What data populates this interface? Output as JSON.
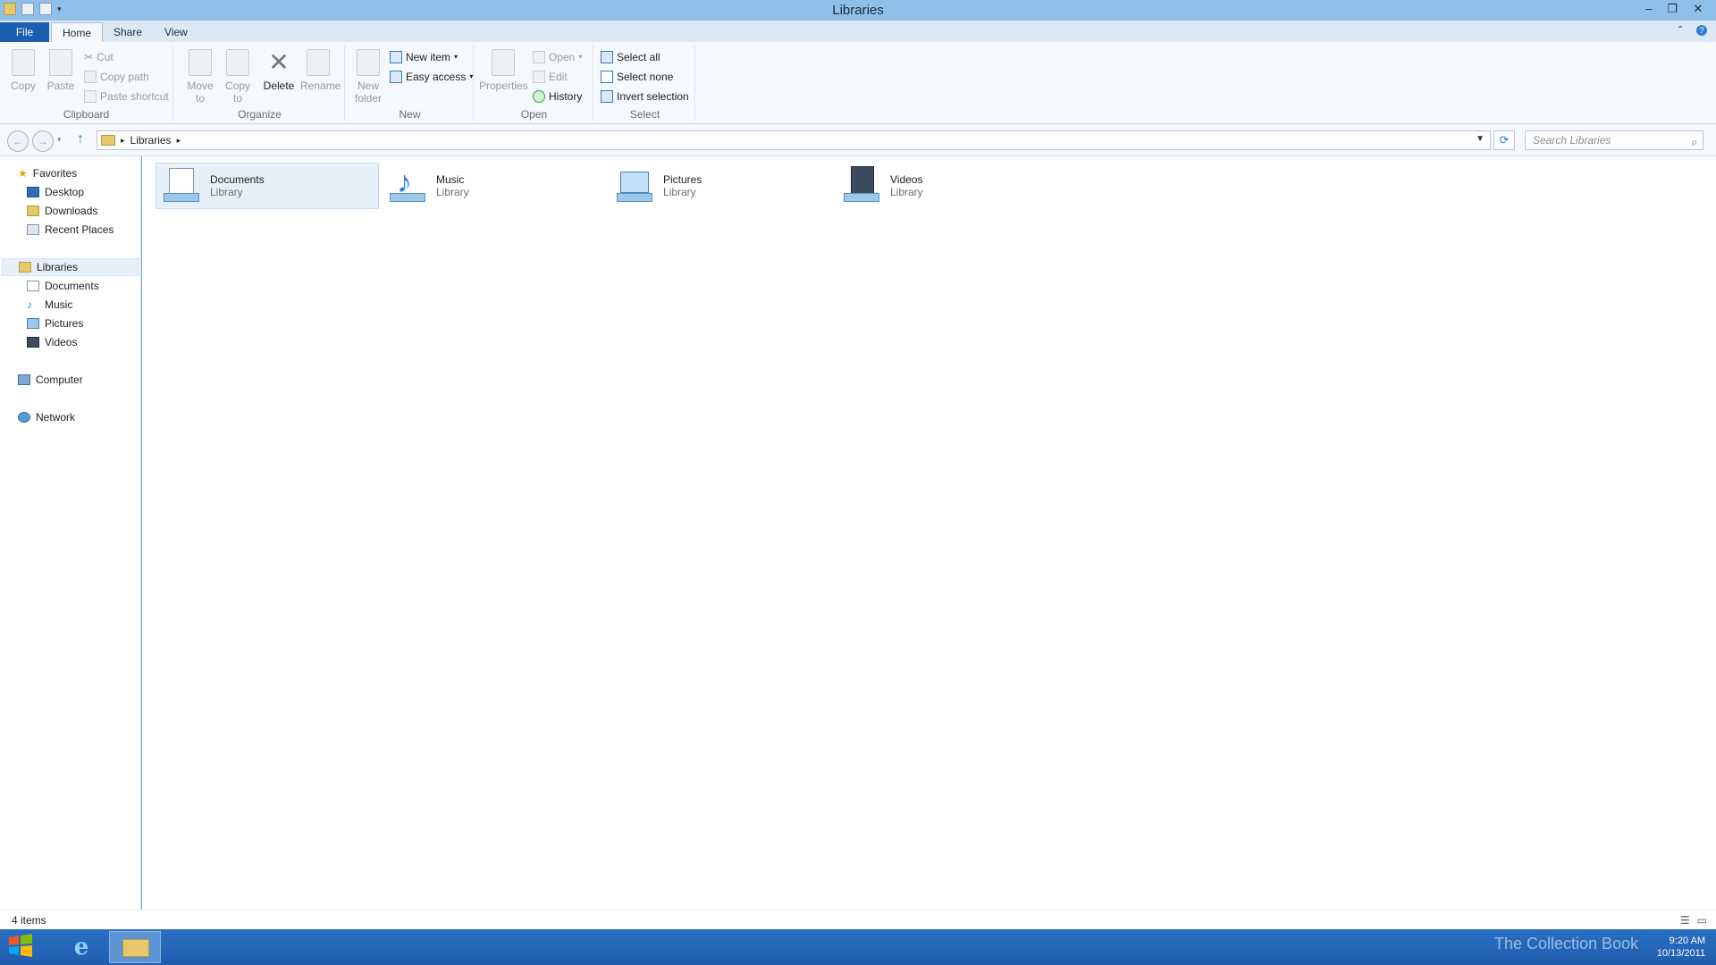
{
  "window": {
    "title": "Libraries",
    "minimize": "–",
    "restore": "❐",
    "close": "✕"
  },
  "ribbon_tabs": [
    "File",
    "Home",
    "Share",
    "View"
  ],
  "ribbon": {
    "clipboard": {
      "label": "Clipboard",
      "copy": "Copy",
      "paste": "Paste",
      "cut": "Cut",
      "copy_path": "Copy path",
      "paste_shortcut": "Paste shortcut"
    },
    "organize": {
      "label": "Organize",
      "move_to": "Move to",
      "copy_to": "Copy to",
      "delete": "Delete",
      "rename": "Rename"
    },
    "new": {
      "label": "New",
      "new_folder": "New folder",
      "new_item": "New item",
      "easy_access": "Easy access"
    },
    "open": {
      "label": "Open",
      "properties": "Properties",
      "open": "Open",
      "edit": "Edit",
      "history": "History"
    },
    "select": {
      "label": "Select",
      "select_all": "Select all",
      "select_none": "Select none",
      "invert_selection": "Invert selection"
    }
  },
  "address": {
    "crumb": "Libraries",
    "search_placeholder": "Search Libraries"
  },
  "nav": {
    "favorites": "Favorites",
    "desktop": "Desktop",
    "downloads": "Downloads",
    "recent_places": "Recent Places",
    "libraries": "Libraries",
    "documents": "Documents",
    "music": "Music",
    "pictures": "Pictures",
    "videos": "Videos",
    "computer": "Computer",
    "network": "Network"
  },
  "libraries": [
    {
      "name": "Documents",
      "type": "Library"
    },
    {
      "name": "Music",
      "type": "Library"
    },
    {
      "name": "Pictures",
      "type": "Library"
    },
    {
      "name": "Videos",
      "type": "Library"
    }
  ],
  "status": {
    "items": "4 items"
  },
  "taskbar": {
    "time": "9:20 AM",
    "date": "10/13/2011",
    "watermark": "The Collection Book"
  },
  "colors": {
    "titlebar": "#8ec0ea",
    "file_tab": "#1c5fb0",
    "taskbar": "#1f5eae",
    "selection": "#e5f0fb"
  }
}
